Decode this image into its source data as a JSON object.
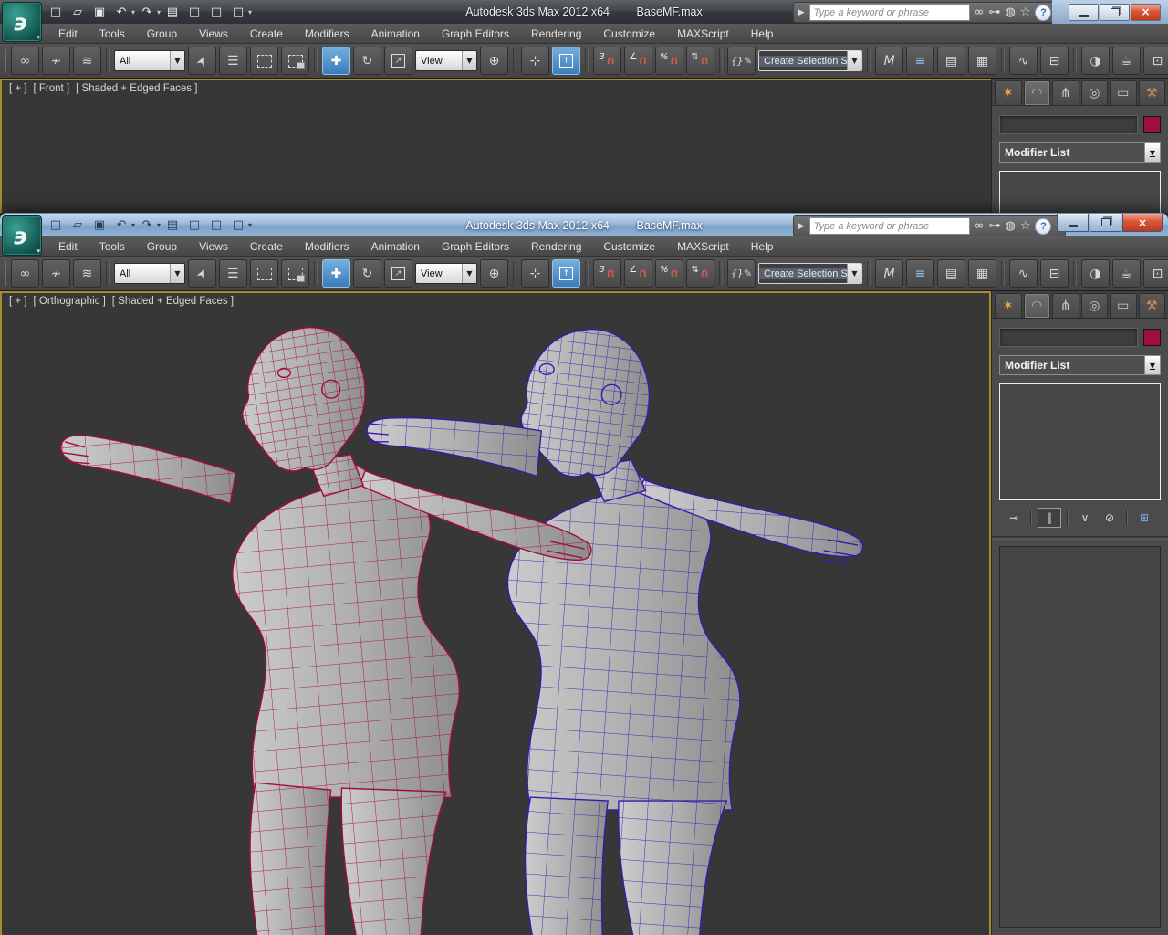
{
  "app": {
    "title_app": "Autodesk 3ds Max  2012 x64",
    "title_file": "BaseMF.max",
    "search_placeholder": "Type a keyword or phrase",
    "menus": [
      "Edit",
      "Tools",
      "Group",
      "Views",
      "Create",
      "Modifiers",
      "Animation",
      "Graph Editors",
      "Rendering",
      "Customize",
      "MAXScript",
      "Help"
    ]
  },
  "toolbar": {
    "selection_filter_value": "All",
    "ref_coord_value": "View",
    "named_sets_value": "Create Selection Se",
    "snap_level": "3"
  },
  "viewports": {
    "back": {
      "plus": "[ + ]",
      "view": "[ Front ]",
      "shading": "[ Shaded + Edged Faces ]"
    },
    "front": {
      "plus": "[ + ]",
      "view": "[ Orthographic ]",
      "shading": "[ Shaded + Edged Faces ]"
    }
  },
  "command_panel": {
    "modifier_list_label": "Modifier List",
    "object_name_value": "",
    "object_color": "#9e0e3e"
  },
  "scene": {
    "shading_mode": "Shaded + Edged Faces",
    "models": [
      {
        "name": "female base mesh",
        "wire_color": "#a50a3c"
      },
      {
        "name": "male base mesh",
        "wire_color": "#3a17ae"
      }
    ]
  },
  "colors": {
    "viewport_bg": "#373737",
    "active_viewport_border": "#a98c2c",
    "active_tool_blue": "#3d7cba",
    "wire_red": "#a50a3c",
    "wire_blue": "#3a17ae",
    "body_gray": "#b4b4b4",
    "titlebar_aero": "#9cbbdc"
  },
  "icons": {
    "logo": "϶",
    "new": "□",
    "open": "▱",
    "save": "▣",
    "undo": "↶",
    "redo": "↷",
    "dropdown": "▾",
    "project": "▤",
    "layout": "□",
    "flyout": "▶",
    "search": "∞",
    "key": "⊶",
    "satellite": "◍",
    "star": "☆",
    "help": "?",
    "link": "∞",
    "unlink": "≁",
    "bind": "≋",
    "select_cursor": "➤",
    "select_by_name": "☰",
    "move": "✚",
    "rotate": "↻",
    "scale": "↗",
    "pivot": "⊕",
    "manipulate": "⊹",
    "keyboard": "↑",
    "magnet": "∩",
    "angle": "∠",
    "percent": "%",
    "spinner": "⇅",
    "braces": "{}",
    "pencil": "✎",
    "mirror": "M",
    "align": "≡",
    "layers": "▤",
    "graphite": "▦",
    "curve": "∿",
    "schematic": "⊟",
    "material": "◑",
    "teapot": "☕",
    "frame": "⊡",
    "combo_arrow": "▼",
    "tab_create": "✶",
    "tab_modify": "◠",
    "tab_hierarchy": "⋔",
    "tab_motion": "◎",
    "tab_display": "▭",
    "tab_utilities": "⚒",
    "pin": "⊸",
    "end_result": "‖",
    "make_unique": "∨",
    "remove": "⊘",
    "configure": "⊞",
    "close": "×"
  }
}
